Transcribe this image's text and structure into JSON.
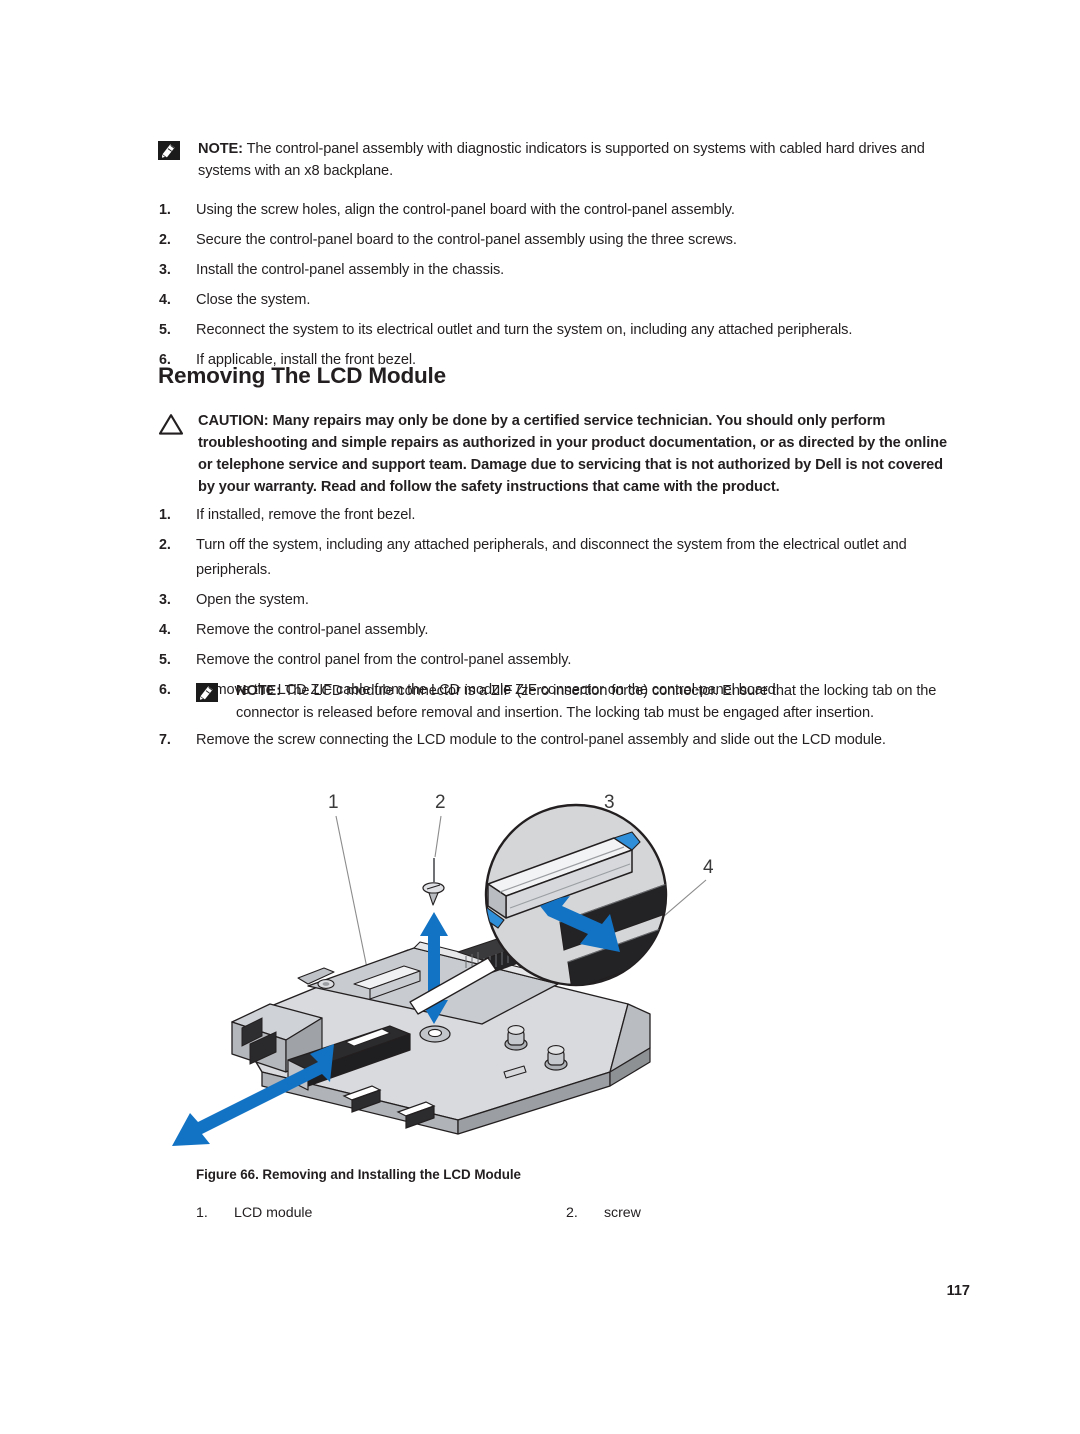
{
  "document": {
    "page_number": "117"
  },
  "top_note": {
    "icon": "note-pencil-icon",
    "label": "NOTE:",
    "text": " The control-panel assembly with diagnostic indicators is supported on systems with cabled hard drives and systems with an x8 backplane."
  },
  "install_steps": {
    "items": [
      {
        "num": "1.",
        "text": "Using the screw holes, align the control-panel board with the control-panel assembly."
      },
      {
        "num": "2.",
        "text": "Secure the control-panel board to the control-panel assembly using the three screws."
      },
      {
        "num": "3.",
        "text": "Install the control-panel assembly in the chassis."
      },
      {
        "num": "4.",
        "text": "Close the system."
      },
      {
        "num": "5.",
        "text": "Reconnect the system to its electrical outlet and turn the system on, including any attached peripherals."
      },
      {
        "num": "6.",
        "text": "If applicable, install the front bezel."
      }
    ]
  },
  "section": {
    "heading": "Removing The LCD Module"
  },
  "caution": {
    "icon": "warning-triangle-icon",
    "label": "CAUTION:",
    "text": " Many repairs may only be done by a certified service technician. You should only perform troubleshooting and simple repairs as authorized in your product documentation, or as directed by the online or telephone service and support team. Damage due to servicing that is not authorized by Dell is not covered by your warranty. Read and follow the safety instructions that came with the product."
  },
  "removal_steps": {
    "items": [
      {
        "num": "1.",
        "text": "If installed, remove the front bezel."
      },
      {
        "num": "2.",
        "text": "Turn off the system, including any attached peripherals, and disconnect the system from the electrical outlet and peripherals."
      },
      {
        "num": "3.",
        "text": "Open the system."
      },
      {
        "num": "4.",
        "text": "Remove the control-panel assembly."
      },
      {
        "num": "5.",
        "text": "Remove the control panel from the control-panel assembly."
      },
      {
        "num": "6.",
        "text": "Remove the LCD ZIF cable from the LCD module ZIF connector on the control-panel board."
      },
      {
        "num": "7.",
        "text": "Remove the screw connecting the LCD module to the control-panel assembly and slide out the LCD module."
      }
    ]
  },
  "zif_note": {
    "icon": "note-pencil-icon",
    "label": "NOTE:",
    "text": " The LCD module connector is a ZIF (zero insertion force) connector. Ensure that the locking tab on the connector is released before removal and insertion. The locking tab must be engaged after insertion."
  },
  "figure": {
    "caption": "Figure 66. Removing and Installing the LCD Module",
    "callouts": [
      "1",
      "2",
      "3",
      "4"
    ],
    "legend": [
      {
        "num": "1.",
        "label": "LCD module"
      },
      {
        "num": "2.",
        "label": "screw"
      }
    ],
    "colors": {
      "arrow_blue": "#1272c4",
      "metal_light": "#e3e4e6",
      "metal_mid": "#c4c6c9",
      "metal_dark": "#8e9194",
      "outline": "#231f20",
      "inset_fill": "#d4d6d8"
    }
  }
}
